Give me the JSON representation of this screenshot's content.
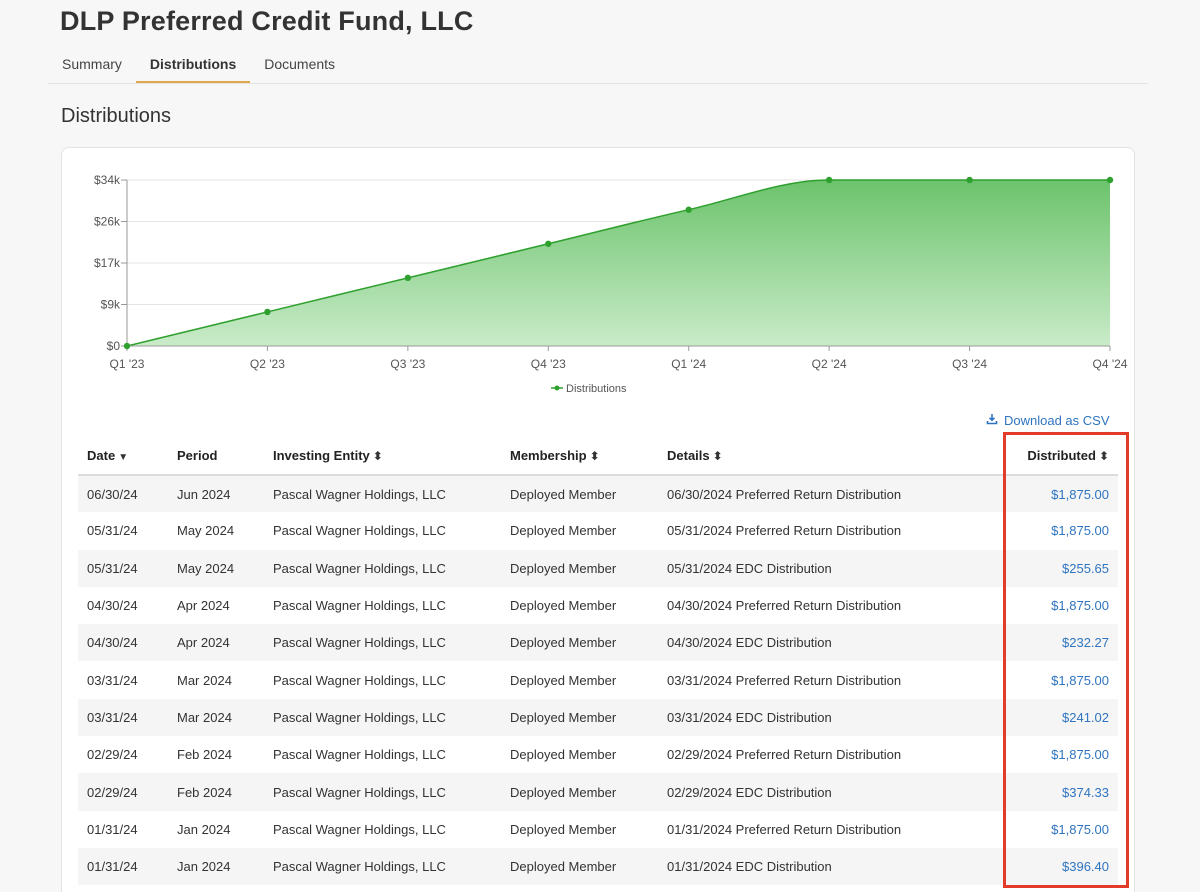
{
  "page": {
    "title": "DLP Preferred Credit Fund, LLC"
  },
  "tabs": [
    {
      "label": "Summary",
      "active": false
    },
    {
      "label": "Distributions",
      "active": true
    },
    {
      "label": "Documents",
      "active": false
    }
  ],
  "section": {
    "title": "Distributions"
  },
  "chart_data": {
    "type": "area",
    "categories": [
      "Q1 '23",
      "Q2 '23",
      "Q3 '23",
      "Q4 '23",
      "Q1 '24",
      "Q2 '24",
      "Q3 '24",
      "Q4 '24"
    ],
    "series": [
      {
        "name": "Distributions",
        "values": [
          0,
          7800,
          15600,
          23400,
          31200,
          38000,
          38000,
          38000
        ]
      }
    ],
    "ylim": [
      0,
      38000
    ],
    "yticks": [
      {
        "value": 0,
        "label": "$0"
      },
      {
        "value": 9500,
        "label": "$9k"
      },
      {
        "value": 19000,
        "label": "$17k"
      },
      {
        "value": 28500,
        "label": "$26k"
      },
      {
        "value": 38000,
        "label": "$34k"
      }
    ],
    "grid": true,
    "legend": "bottom-center",
    "colors": {
      "line": "#2ea02e",
      "fill_top": "#6cc36c",
      "fill_bottom": "#c9ebc9"
    }
  },
  "download": {
    "label": "Download as CSV",
    "icon": "download-icon"
  },
  "table": {
    "columns": [
      {
        "label": "Date",
        "sort": "desc"
      },
      {
        "label": "Period",
        "sort": "none"
      },
      {
        "label": "Investing Entity",
        "sort": "both"
      },
      {
        "label": "Membership",
        "sort": "both"
      },
      {
        "label": "Details",
        "sort": "both"
      },
      {
        "label": "Distributed",
        "sort": "both"
      }
    ],
    "rows": [
      [
        "06/30/24",
        "Jun 2024",
        "Pascal Wagner Holdings, LLC",
        "Deployed Member",
        "06/30/2024 Preferred Return Distribution",
        "$1,875.00"
      ],
      [
        "05/31/24",
        "May 2024",
        "Pascal Wagner Holdings, LLC",
        "Deployed Member",
        "05/31/2024 Preferred Return Distribution",
        "$1,875.00"
      ],
      [
        "05/31/24",
        "May 2024",
        "Pascal Wagner Holdings, LLC",
        "Deployed Member",
        "05/31/2024 EDC Distribution",
        "$255.65"
      ],
      [
        "04/30/24",
        "Apr 2024",
        "Pascal Wagner Holdings, LLC",
        "Deployed Member",
        "04/30/2024 Preferred Return Distribution",
        "$1,875.00"
      ],
      [
        "04/30/24",
        "Apr 2024",
        "Pascal Wagner Holdings, LLC",
        "Deployed Member",
        "04/30/2024 EDC Distribution",
        "$232.27"
      ],
      [
        "03/31/24",
        "Mar 2024",
        "Pascal Wagner Holdings, LLC",
        "Deployed Member",
        "03/31/2024 Preferred Return Distribution",
        "$1,875.00"
      ],
      [
        "03/31/24",
        "Mar 2024",
        "Pascal Wagner Holdings, LLC",
        "Deployed Member",
        "03/31/2024 EDC Distribution",
        "$241.02"
      ],
      [
        "02/29/24",
        "Feb 2024",
        "Pascal Wagner Holdings, LLC",
        "Deployed Member",
        "02/29/2024 Preferred Return Distribution",
        "$1,875.00"
      ],
      [
        "02/29/24",
        "Feb 2024",
        "Pascal Wagner Holdings, LLC",
        "Deployed Member",
        "02/29/2024 EDC Distribution",
        "$374.33"
      ],
      [
        "01/31/24",
        "Jan 2024",
        "Pascal Wagner Holdings, LLC",
        "Deployed Member",
        "01/31/2024 Preferred Return Distribution",
        "$1,875.00"
      ],
      [
        "01/31/24",
        "Jan 2024",
        "Pascal Wagner Holdings, LLC",
        "Deployed Member",
        "01/31/2024 EDC Distribution",
        "$396.40"
      ]
    ]
  },
  "annotation": {
    "color": "#e23b2a"
  }
}
